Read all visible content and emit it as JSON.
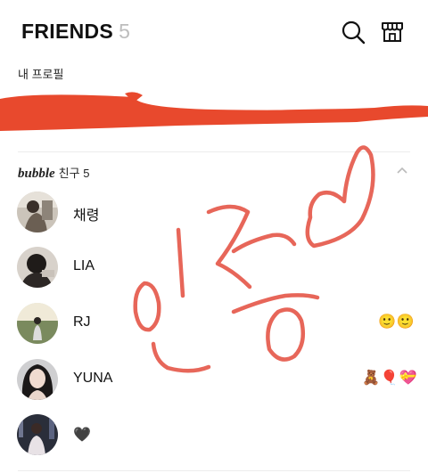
{
  "header": {
    "title": "FRIENDS",
    "count": "5"
  },
  "my_profile": {
    "label": "내 프로필"
  },
  "section": {
    "brand": "bubble",
    "label": "친구 5"
  },
  "friends": [
    {
      "name": "채령",
      "stickers": ""
    },
    {
      "name": "LIA",
      "stickers": ""
    },
    {
      "name": "RJ",
      "stickers": "🙂🙂"
    },
    {
      "name": "YUNA",
      "stickers": "🧸🎈💝"
    },
    {
      "name": "🖤",
      "stickers": ""
    }
  ],
  "colors": {
    "accent": "#e8492d",
    "scribble": "#e55a4c",
    "divider": "#ececec"
  },
  "icons": [
    "search-icon",
    "shop-icon",
    "chevron-up-icon"
  ]
}
